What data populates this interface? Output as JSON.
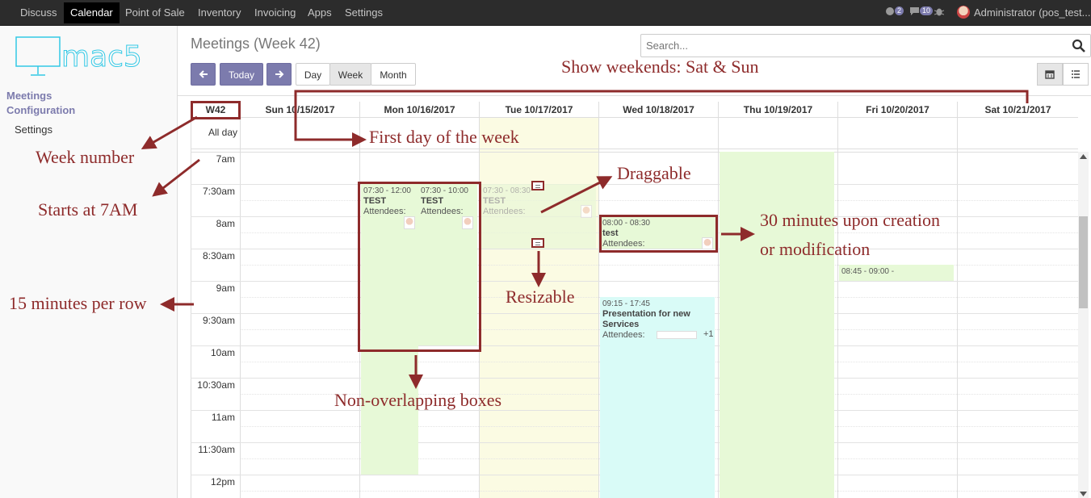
{
  "topbar": {
    "menu": [
      "Discuss",
      "Calendar",
      "Point of Sale",
      "Inventory",
      "Invoicing",
      "Apps",
      "Settings"
    ],
    "active": "Calendar",
    "chat_count": "2",
    "message_count": "10",
    "user": "Administrator (pos_test..."
  },
  "sidebar": {
    "logo_text": "mac5",
    "section1": "Meetings",
    "section2": "Configuration",
    "item": "Settings"
  },
  "header": {
    "title": "Meetings (Week 42)",
    "today_label": "Today",
    "day_label": "Day",
    "week_label": "Week",
    "month_label": "Month",
    "search_placeholder": "Search..."
  },
  "calendar": {
    "week_label": "W42",
    "days": [
      "Sun 10/15/2017",
      "Mon 10/16/2017",
      "Tue 10/17/2017",
      "Wed 10/18/2017",
      "Thu 10/19/2017",
      "Fri 10/20/2017",
      "Sat 10/21/2017"
    ],
    "all_day": "All day",
    "times": [
      "7am",
      "7:30am",
      "8am",
      "8:30am",
      "9am",
      "9:30am",
      "10am",
      "10:30am",
      "11am",
      "11:30am",
      "12pm"
    ],
    "events": {
      "e1": {
        "time": "07:30 - 12:00",
        "name": "TEST",
        "attendees": "Attendees:"
      },
      "e2": {
        "time": "07:30 - 10:00",
        "name": "TEST",
        "attendees": "Attendees:"
      },
      "e3": {
        "time": "07:30 - 08:30",
        "name": "TEST",
        "attendees": "Attendees:"
      },
      "e4": {
        "time": "08:00 - 08:30",
        "name": "test",
        "attendees": "Attendees:"
      },
      "e5": {
        "time": "09:15 - 17:45",
        "name": "Presentation for new Services",
        "attendees": "Attendees:",
        "extra": "+1"
      },
      "e6": {
        "time": "08:45 - 09:00 -"
      }
    }
  },
  "annotations": {
    "weekends": "Show weekends: Sat & Sun",
    "first_day": "First day of the week",
    "week_number": "Week number",
    "starts": "Starts at 7AM",
    "draggable": "Draggable",
    "thirty": "30 minutes upon creation",
    "modification": "or modification",
    "fifteen": "15 minutes per row",
    "resizable": "Resizable",
    "nonoverlap": "Non-overlapping boxes"
  },
  "colors": {
    "brand": "#7c7bad",
    "annotation": "#8e2b2b",
    "event_green": "#e7f9d7",
    "event_yellow": "#fbfbe3",
    "event_cyan": "#d9fbf7"
  }
}
